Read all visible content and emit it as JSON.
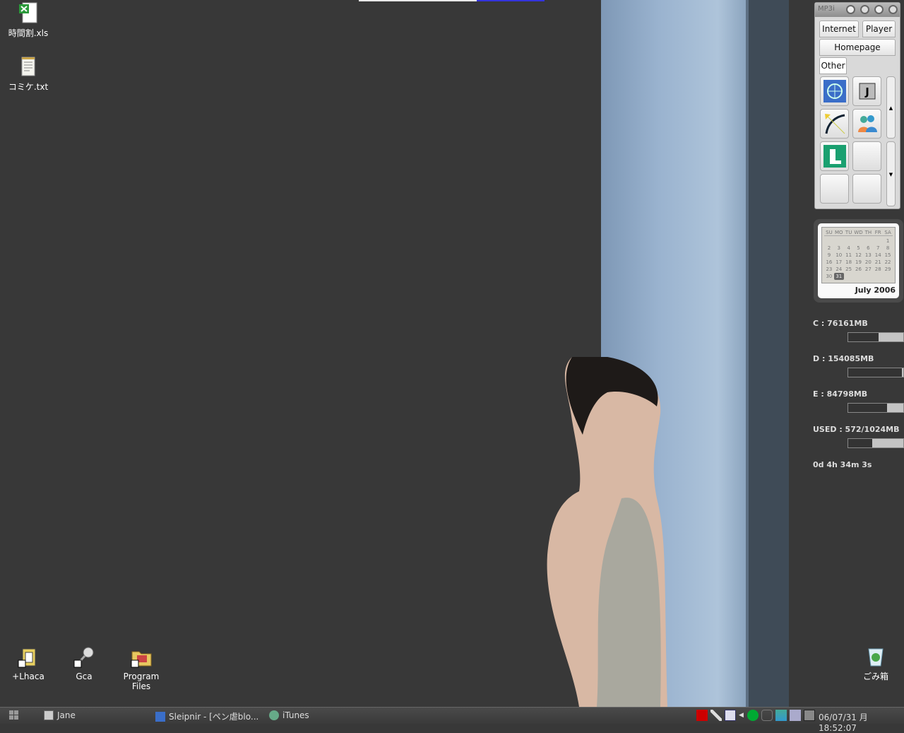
{
  "desktop": {
    "icons_top": [
      {
        "label": "時間割.xls",
        "icon": "excel-file-icon"
      },
      {
        "label": "コミケ.txt",
        "icon": "text-file-icon"
      }
    ],
    "icons_bottom": [
      {
        "label": "+Lhaca",
        "icon": "lhaca-shortcut-icon"
      },
      {
        "label": "Gca",
        "icon": "gca-shortcut-icon"
      },
      {
        "label": "Program Files",
        "icon": "folder-shortcut-icon"
      }
    ],
    "recycle_bin": "ごみ箱"
  },
  "launcher": {
    "title": "MP3i",
    "tabs": [
      "Internet",
      "Player",
      "Homepage",
      "Other"
    ],
    "items": [
      "sleipnir-icon",
      "jane-icon",
      "bow-arrow-icon",
      "messenger-icon",
      "lhaca-icon",
      "",
      "",
      ""
    ]
  },
  "calendar": {
    "weekdays": [
      "SU",
      "MO",
      "TU",
      "WD",
      "TH",
      "FR",
      "SA"
    ],
    "month": "July 2006",
    "today": "31",
    "weeks": [
      [
        "",
        "",
        "",
        "",
        "",
        "",
        "1"
      ],
      [
        "2",
        "3",
        "4",
        "5",
        "6",
        "7",
        "8"
      ],
      [
        "9",
        "10",
        "11",
        "12",
        "13",
        "14",
        "15"
      ],
      [
        "16",
        "17",
        "18",
        "19",
        "20",
        "21",
        "22"
      ],
      [
        "23",
        "24",
        "25",
        "26",
        "27",
        "28",
        "29"
      ],
      [
        "30",
        "31",
        "",
        "",
        "",
        "",
        ""
      ]
    ]
  },
  "system": {
    "disks": [
      {
        "label": "C : 76161MB",
        "fill": 0.45
      },
      {
        "label": "D : 154085MB",
        "fill": 0.03
      },
      {
        "label": "E : 84798MB",
        "fill": 0.29
      },
      {
        "label": "USED : 572/1024MB",
        "fill": 0.56
      }
    ],
    "uptime": "0d 4h 34m 3s"
  },
  "taskbar": {
    "tasks": [
      {
        "label": "Jane"
      },
      {
        "label": "Sleipnir - [ペン虐blo..."
      },
      {
        "label": "iTunes"
      }
    ],
    "tray_icons": [
      "acrobat-icon",
      "microphone-icon",
      "notepad-icon",
      "expand-arrow-icon",
      "network-globe-icon",
      "cat-icon",
      "messenger-icon",
      "wireless-icon",
      "antivirus-icon"
    ],
    "clock": "06/07/31 月 18:52:07"
  }
}
